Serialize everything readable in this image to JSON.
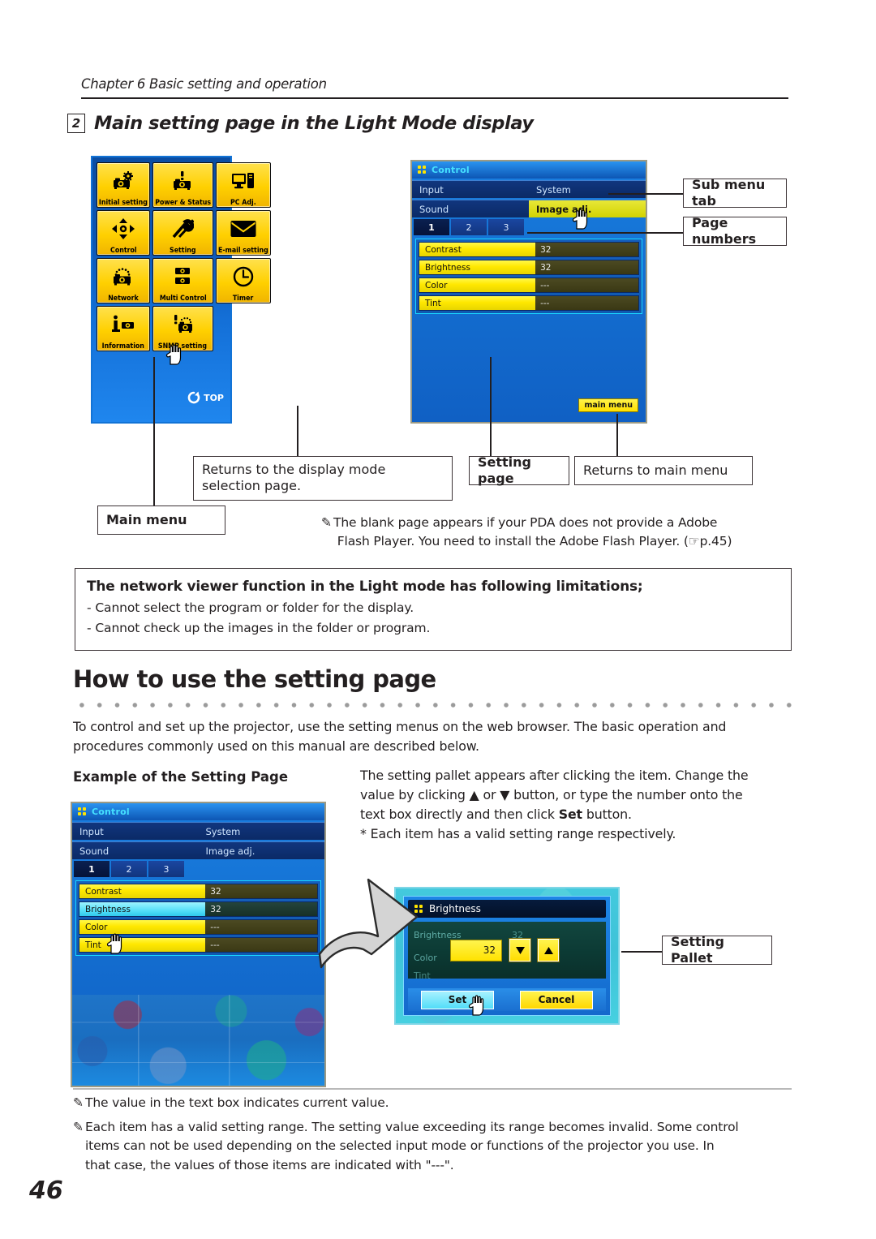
{
  "header": {
    "chapter": "Chapter 6 Basic setting and operation",
    "section_number": "2",
    "section_title": "Main setting page in the Light Mode display"
  },
  "main_menu_screenshot": {
    "top_label": "TOP",
    "tiles": [
      {
        "label": "Initial setting",
        "icon": "projector-gear-icon"
      },
      {
        "label": "Power & Status",
        "icon": "projector-exclaim-icon"
      },
      {
        "label": "PC Adj.",
        "icon": "monitor-pc-icon"
      },
      {
        "label": "Control",
        "icon": "four-way-arrows-icon"
      },
      {
        "label": "Setting",
        "icon": "wrench-screwdriver-icon"
      },
      {
        "label": "E-mail setting",
        "icon": "envelope-icon"
      },
      {
        "label": "Network",
        "icon": "projector-network-icon"
      },
      {
        "label": "Multi Control",
        "icon": "two-projectors-icon"
      },
      {
        "label": "Timer",
        "icon": "clock-icon"
      },
      {
        "label": "Information",
        "icon": "info-projector-icon"
      },
      {
        "label": "SNMP setting",
        "icon": "projector-alert-icon"
      }
    ]
  },
  "control_screenshot_top": {
    "title": "Control",
    "tabs": [
      {
        "label": "Input",
        "active": false
      },
      {
        "label": "System",
        "active": false
      },
      {
        "label": "Sound",
        "active": false
      },
      {
        "label": "Image adj.",
        "active": true
      }
    ],
    "pages": [
      "1",
      "2",
      "3"
    ],
    "active_page": "1",
    "items": [
      {
        "name": "Contrast",
        "value": "32",
        "highlighted": false
      },
      {
        "name": "Brightness",
        "value": "32",
        "highlighted": false
      },
      {
        "name": "Color",
        "value": "---",
        "highlighted": false
      },
      {
        "name": "Tint",
        "value": "---",
        "highlighted": false
      }
    ],
    "main_menu_button": "main menu"
  },
  "callouts": {
    "sub_menu_tab": "Sub menu tab",
    "page_numbers": "Page numbers",
    "returns_display_mode": "Returns to the display mode selection page.",
    "setting_page": "Setting page",
    "returns_main_menu": "Returns to main menu",
    "main_menu": "Main menu",
    "setting_pallet": "Setting Pallet"
  },
  "pda_note": "The blank page appears if your PDA does not provide a Adobe Flash Player. You need to install the Adobe Flash Player. (+p.45)",
  "pda_note_line1": "The blank page appears if your PDA does not provide a Adobe",
  "pda_note_line2": "Flash Player. You need to install the Adobe Flash Player. (",
  "pda_note_line2_ref": "p.45)",
  "limitations": {
    "title": "The network viewer function in the Light mode has following limitations;",
    "items": [
      "- Cannot select the program or folder for the display.",
      "- Cannot check up the images in the folder or program."
    ]
  },
  "section2": {
    "heading": "How to use the setting page",
    "intro_line1": "To control and set up the projector, use the setting menus on the web browser. The basic operation and",
    "intro_line2": "procedures commonly used on this manual are described below.",
    "example_heading": "Example of the Setting Page",
    "right_line1": "The setting pallet appears after clicking the item. Change the",
    "right_line2a": "value by clicking ",
    "right_line2b": " or ",
    "right_line2c": " button, or type the number onto the",
    "right_line3a": "text box directly and then click ",
    "right_line3b": "Set",
    "right_line3c": " button.",
    "right_line4": "* Each item has a valid setting range respectively.",
    "up_arrow_glyph": "▲",
    "down_arrow_glyph": "▼"
  },
  "control_screenshot_bottom": {
    "title": "Control",
    "tabs": [
      {
        "label": "Input",
        "active": false
      },
      {
        "label": "System",
        "active": false
      },
      {
        "label": "Sound",
        "active": false
      },
      {
        "label": "Image adj.",
        "active": false
      }
    ],
    "pages": [
      "1",
      "2",
      "3"
    ],
    "active_page": "1",
    "items": [
      {
        "name": "Contrast",
        "value": "32",
        "highlighted": false
      },
      {
        "name": "Brightness",
        "value": "32",
        "highlighted": true
      },
      {
        "name": "Color",
        "value": "---",
        "highlighted": false
      },
      {
        "name": "Tint",
        "value": "---",
        "highlighted": false
      }
    ]
  },
  "setting_pallet": {
    "title": "Brightness",
    "input_value": "32",
    "down_button": "▼",
    "up_button": "▲",
    "set_button": "Set",
    "cancel_button": "Cancel",
    "ghost_rows": [
      "Brightness",
      "Color",
      "Tint"
    ],
    "ghost_values": [
      "32",
      "---"
    ]
  },
  "footnotes": [
    "The value in the text box indicates current value.",
    "Each item has a valid setting range. The setting value exceeding its range becomes invalid. Some control items can not be used depending on the selected input mode or functions of the projector you use. In that case, the values of those items are indicated with \"---\"."
  ],
  "footnote2_lines": [
    "Each item has a valid setting range. The setting value exceeding its range becomes invalid. Some control",
    "items can not be used depending on the selected input mode or functions of the projector you use. In",
    "that case, the values of those items are indicated with \"---\"."
  ],
  "page_number": "46",
  "colors": {
    "tile_yellow": "#ffd000",
    "panel_blue": "#1470d2",
    "accent_cyan": "#45e0ff",
    "text": "#231f20"
  }
}
